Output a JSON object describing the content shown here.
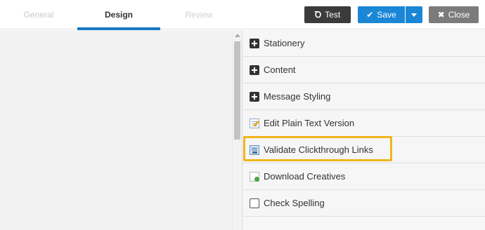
{
  "tabs": {
    "general": "General",
    "design": "Design",
    "review": "Review"
  },
  "toolbar": {
    "test_label": "Test",
    "test_glyph": "Ꝺ",
    "save_label": "Save",
    "save_glyph": "✔",
    "close_label": "Close",
    "close_glyph": "✖"
  },
  "panel": {
    "items": [
      {
        "label": "Stationery",
        "icon": "plus-square-icon"
      },
      {
        "label": "Content",
        "icon": "plus-square-icon"
      },
      {
        "label": "Message Styling",
        "icon": "plus-square-icon"
      },
      {
        "label": "Edit Plain Text Version",
        "icon": "edit-document-icon"
      },
      {
        "label": "Validate Clickthrough Links",
        "icon": "validate-links-icon"
      },
      {
        "label": "Download Creatives",
        "icon": "download-document-icon"
      },
      {
        "label": "Check Spelling",
        "icon": "checkbox-icon"
      }
    ]
  },
  "colors": {
    "accent": "#1b86d6",
    "tab_underline": "#1778c2",
    "highlight": "#f1b51c",
    "test_button": "#3b3b3b",
    "close_button": "#7b7b7b"
  }
}
